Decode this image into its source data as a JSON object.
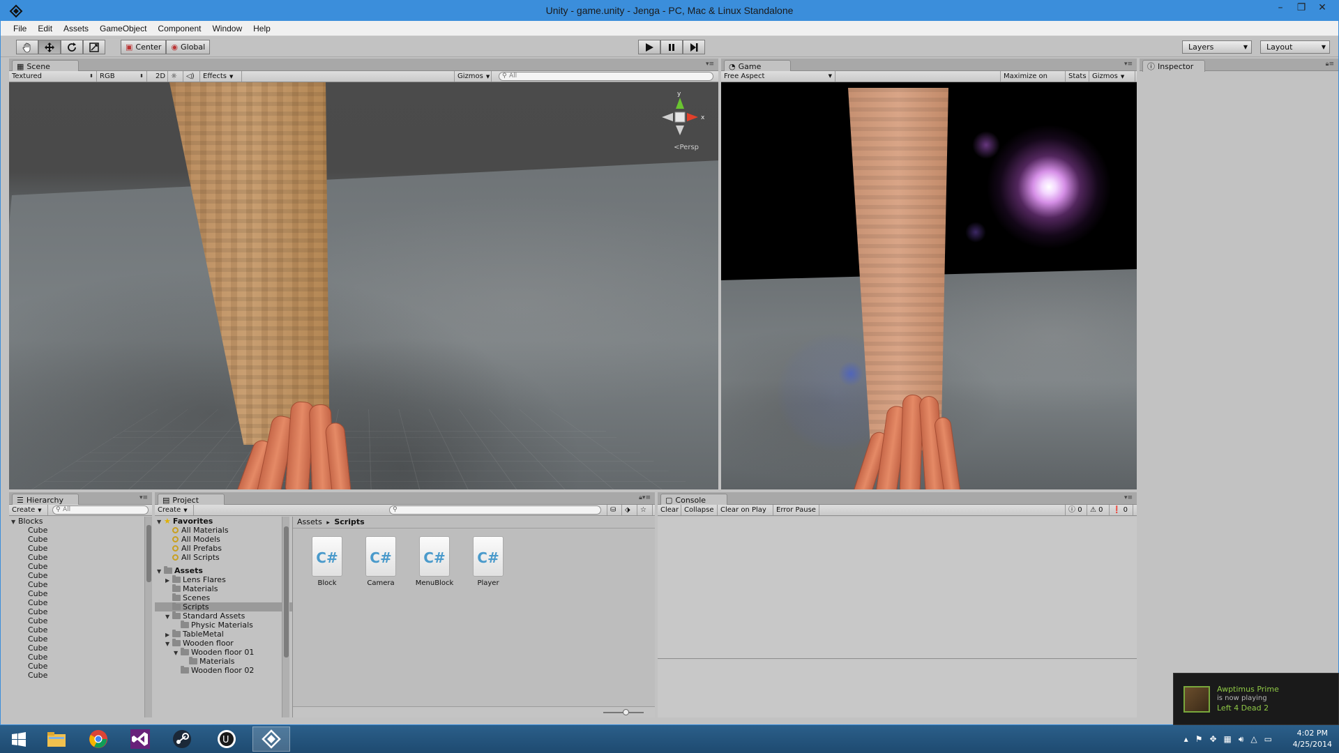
{
  "window": {
    "title": "Unity - game.unity - Jenga - PC, Mac & Linux Standalone",
    "minimize": "–",
    "maximize": "❐",
    "close": "✕"
  },
  "menu": [
    "File",
    "Edit",
    "Assets",
    "GameObject",
    "Component",
    "Window",
    "Help"
  ],
  "toolbar": {
    "pivot": "Center",
    "space": "Global",
    "layers": "Layers",
    "layout": "Layout"
  },
  "scene": {
    "tab": "Scene",
    "shading": "Textured",
    "render_mode": "RGB",
    "mode_2d": "2D",
    "effects": "Effects",
    "gizmos": "Gizmos",
    "search": "All",
    "axis_y": "y",
    "axis_x": "x",
    "persp": "Persp"
  },
  "game": {
    "tab": "Game",
    "aspect": "Free Aspect",
    "maximize": "Maximize on Play",
    "stats": "Stats",
    "gizmos": "Gizmos"
  },
  "inspector": {
    "tab": "Inspector"
  },
  "hierarchy": {
    "tab": "Hierarchy",
    "create": "Create",
    "search": "All",
    "root": "Blocks",
    "items": [
      "Cube",
      "Cube",
      "Cube",
      "Cube",
      "Cube",
      "Cube",
      "Cube",
      "Cube",
      "Cube",
      "Cube",
      "Cube",
      "Cube",
      "Cube",
      "Cube",
      "Cube",
      "Cube",
      "Cube"
    ]
  },
  "project": {
    "tab": "Project",
    "create": "Create",
    "favorites_label": "Favorites",
    "favorites": [
      "All Materials",
      "All Models",
      "All Prefabs",
      "All Scripts"
    ],
    "assets_label": "Assets",
    "tree": [
      {
        "label": "Lens Flares",
        "indent": 1,
        "arrow": "▶"
      },
      {
        "label": "Materials",
        "indent": 1,
        "arrow": ""
      },
      {
        "label": "Scenes",
        "indent": 1,
        "arrow": ""
      },
      {
        "label": "Scripts",
        "indent": 1,
        "arrow": "",
        "selected": true
      },
      {
        "label": "Standard Assets",
        "indent": 1,
        "arrow": "▼"
      },
      {
        "label": "Physic Materials",
        "indent": 2,
        "arrow": ""
      },
      {
        "label": "TableMetal",
        "indent": 1,
        "arrow": "▶"
      },
      {
        "label": "Wooden floor",
        "indent": 1,
        "arrow": "▼"
      },
      {
        "label": "Wooden floor 01",
        "indent": 2,
        "arrow": "▼"
      },
      {
        "label": "Materials",
        "indent": 3,
        "arrow": ""
      },
      {
        "label": "Wooden floor 02",
        "indent": 2,
        "arrow": ""
      }
    ],
    "breadcrumb_root": "Assets",
    "breadcrumb_sep": "▸",
    "breadcrumb_current": "Scripts",
    "files": [
      "Block",
      "Camera",
      "MenuBlock",
      "Player"
    ],
    "file_icon": "C#"
  },
  "console": {
    "tab": "Console",
    "clear": "Clear",
    "collapse": "Collapse",
    "clear_on_play": "Clear on Play",
    "error_pause": "Error Pause",
    "info_count": "0",
    "warn_count": "0",
    "error_count": "0"
  },
  "notification": {
    "user": "Awptimus Prime",
    "status": "is now playing",
    "game": "Left 4 Dead 2"
  },
  "clock": {
    "time": "4:02 PM",
    "date": "4/25/2014"
  },
  "colors": {
    "title_bar": "#3b8edb",
    "editor_bg": "#c2c2c2",
    "steam_green": "#8fc846"
  }
}
